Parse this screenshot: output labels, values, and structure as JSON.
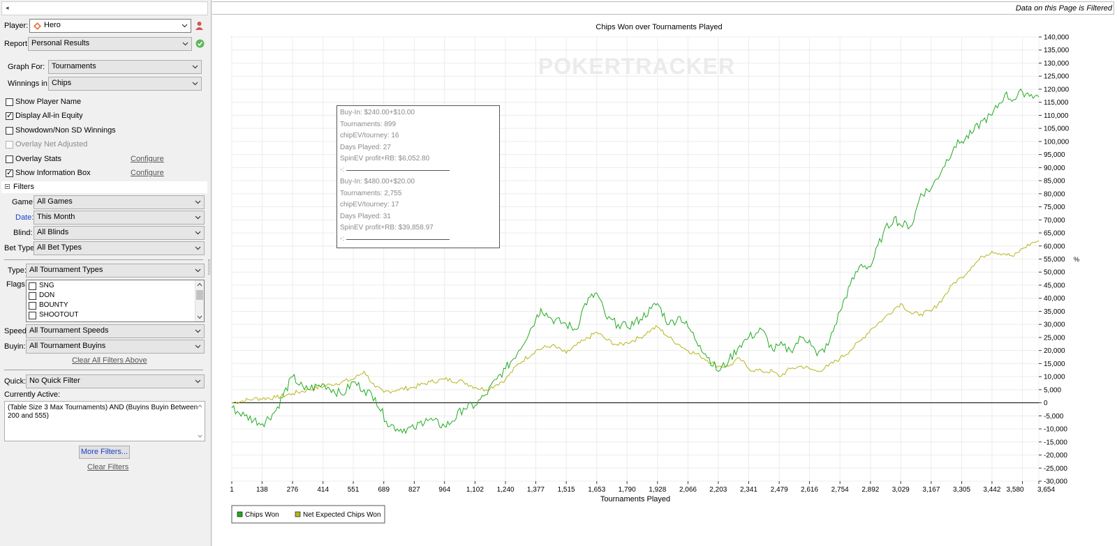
{
  "left": {
    "top_strip": "◂",
    "player": {
      "label": "Player:",
      "value": "Hero"
    },
    "report": {
      "label": "Report:",
      "value": "Personal Results"
    },
    "graph_for": {
      "label": "Graph For:",
      "value": "Tournaments"
    },
    "winnings_in": {
      "label": "Winnings in:",
      "value": "Chips"
    },
    "options": [
      {
        "label": "Show Player Name",
        "checked": false,
        "disabled": false
      },
      {
        "label": "Display All-in Equity",
        "checked": true,
        "disabled": false
      },
      {
        "label": "Showdown/Non SD Winnings",
        "checked": false,
        "disabled": false
      },
      {
        "label": "Overlay Net Adjusted",
        "checked": false,
        "disabled": true
      },
      {
        "label": "Overlay Stats",
        "checked": false,
        "disabled": false,
        "configure": "Configure"
      },
      {
        "label": "Show Information Box",
        "checked": true,
        "disabled": false,
        "configure": "Configure"
      }
    ],
    "filters_header": "Filters",
    "game": {
      "label": "Game:",
      "value": "All Games"
    },
    "date": {
      "label": "Date:",
      "value": "This Month"
    },
    "blind": {
      "label": "Blind:",
      "value": "All Blinds"
    },
    "bet_type": {
      "label": "Bet Type:",
      "value": "All Bet Types"
    },
    "type": {
      "label": "Type:",
      "value": "All Tournament Types"
    },
    "flags": {
      "label": "Flags:",
      "items": [
        "SNG",
        "DON",
        "BOUNTY",
        "SHOOTOUT"
      ]
    },
    "speed": {
      "label": "Speed:",
      "value": "All Tournament Speeds"
    },
    "buyin": {
      "label": "Buyin:",
      "value": "All Tournament Buyins"
    },
    "clear_above": "Clear All Filters Above",
    "quick": {
      "label": "Quick:",
      "value": "No Quick Filter"
    },
    "currently_active_label": "Currently Active:",
    "currently_active_text": "(Table Size 3 Max Tournaments) AND (Buyins Buyin Between 200 and 555)",
    "more_filters": "More Filters...",
    "clear_filters": "Clear Filters"
  },
  "banner": "Data on this Page is Filtered",
  "colors": {
    "chips_won": "#22aa22",
    "net_expected": "#b5b51c",
    "date_label": "#1a3fc8"
  },
  "chart_data": {
    "type": "line",
    "title": "Chips Won over Tournaments Played",
    "watermark": "POKERTRACKER",
    "xlabel": "Tournaments Played",
    "ylabel": "",
    "ylim": [
      -30000,
      140000
    ],
    "xlim": [
      1,
      3654
    ],
    "y_ticks": [
      "140,000",
      "135,000",
      "130,000",
      "125,000",
      "120,000",
      "115,000",
      "110,000",
      "105,000",
      "100,000",
      "95,000",
      "90,000",
      "85,000",
      "80,000",
      "75,000",
      "70,000",
      "65,000",
      "60,000",
      "55,000",
      "50,000",
      "45,000",
      "40,000",
      "35,000",
      "30,000",
      "25,000",
      "20,000",
      "15,000",
      "10,000",
      "5,000",
      "0",
      "-5,000",
      "-10,000",
      "-15,000",
      "-20,000",
      "-25,000",
      "-30,000"
    ],
    "x_ticks": [
      "1",
      "138",
      "276",
      "414",
      "551",
      "689",
      "827",
      "964",
      "1,102",
      "1,240",
      "1,377",
      "1,515",
      "1,653",
      "1,790",
      "1,928",
      "2,066",
      "2,203",
      "2,341",
      "2,479",
      "2,616",
      "2,754",
      "2,892",
      "3,029",
      "3,167",
      "3,305",
      "3,442",
      "3,580",
      "3,654"
    ],
    "right_axis_label": "%",
    "legend_position": "bottom-left",
    "series": [
      {
        "name": "Chips Won",
        "x": [
          1,
          60,
          140,
          200,
          276,
          330,
          420,
          500,
          551,
          600,
          650,
          700,
          750,
          827,
          880,
          964,
          1000,
          1050,
          1102,
          1150,
          1200,
          1240,
          1300,
          1377,
          1400,
          1450,
          1515,
          1560,
          1600,
          1653,
          1700,
          1750,
          1790,
          1850,
          1900,
          1928,
          1980,
          2030,
          2066,
          2120,
          2203,
          2250,
          2300,
          2341,
          2400,
          2450,
          2479,
          2530,
          2580,
          2616,
          2650,
          2700,
          2754,
          2800,
          2850,
          2892,
          2950,
          3000,
          3029,
          3080,
          3120,
          3167,
          3220,
          3270,
          3305,
          3350,
          3400,
          3442,
          3500,
          3540,
          3580,
          3620,
          3654
        ],
        "y": [
          -2000,
          -5000,
          -8000,
          -3000,
          10000,
          5000,
          7000,
          3000,
          8000,
          5000,
          2000,
          -7000,
          -10000,
          -10000,
          -6000,
          -9000,
          -7000,
          -2000,
          -1000,
          3000,
          9000,
          13000,
          20000,
          32000,
          36000,
          32000,
          30000,
          28000,
          38000,
          42000,
          32000,
          30000,
          29000,
          32000,
          36000,
          38000,
          30000,
          33000,
          29000,
          22000,
          12000,
          16000,
          22000,
          25000,
          28000,
          20000,
          22000,
          20000,
          25000,
          24000,
          18000,
          22000,
          35000,
          45000,
          53000,
          52000,
          65000,
          71000,
          68000,
          68000,
          80000,
          82000,
          90000,
          98000,
          100000,
          103000,
          108000,
          110000,
          118000,
          116000,
          119000,
          118000,
          117000
        ]
      },
      {
        "name": "Net Expected Chips Won",
        "x": [
          1,
          100,
          200,
          276,
          350,
          450,
          551,
          600,
          650,
          689,
          750,
          827,
          900,
          964,
          1050,
          1102,
          1150,
          1200,
          1240,
          1300,
          1377,
          1450,
          1515,
          1560,
          1600,
          1653,
          1700,
          1750,
          1790,
          1850,
          1900,
          1928,
          1980,
          2030,
          2066,
          2120,
          2203,
          2250,
          2300,
          2341,
          2400,
          2450,
          2479,
          2530,
          2580,
          2616,
          2650,
          2700,
          2754,
          2800,
          2850,
          2892,
          2950,
          3000,
          3029,
          3080,
          3120,
          3167,
          3220,
          3270,
          3305,
          3350,
          3400,
          3442,
          3500,
          3540,
          3580,
          3620,
          3654
        ],
        "y": [
          0,
          1500,
          2000,
          3500,
          5000,
          7000,
          9000,
          12000,
          6000,
          4000,
          5000,
          6000,
          8000,
          9000,
          8000,
          6000,
          5000,
          7000,
          9000,
          15000,
          20000,
          22000,
          19000,
          22000,
          24000,
          27000,
          24000,
          22000,
          23000,
          25000,
          28000,
          29000,
          25000,
          22000,
          20000,
          18000,
          14000,
          14000,
          17000,
          13000,
          12000,
          12000,
          10000,
          13000,
          14000,
          13000,
          12000,
          14000,
          17000,
          20000,
          24000,
          28000,
          32000,
          36000,
          38000,
          34000,
          34000,
          35000,
          40000,
          46000,
          48000,
          52000,
          56000,
          58000,
          57000,
          56000,
          59000,
          61000,
          62000
        ]
      }
    ]
  },
  "infobox": {
    "rows": [
      "Buy-In: $240.00+$10.00",
      "Tournaments: 899",
      "chipEV/tourney: 16",
      "Days Played: 27",
      "SpinEV profit+RB: $6,052.80",
      "-:",
      "Buy-In: $480.00+$20.00",
      "Tournaments: 2,755",
      "chipEV/tourney: 17",
      "Days Played: 31",
      "SpinEV profit+RB: $39,858.97",
      "-:"
    ]
  }
}
